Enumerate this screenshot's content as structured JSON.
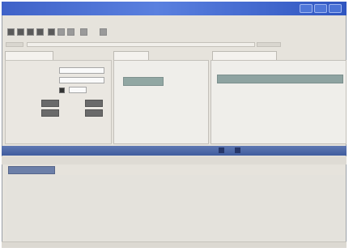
{
  "window": {
    "title": "",
    "controls": [
      "minimize-icon",
      "maximize-icon",
      "close-icon"
    ]
  },
  "menubar": {
    "items": []
  },
  "toolbar": {
    "text": ""
  },
  "tabs": {
    "left": "",
    "mid": "",
    "right": ""
  },
  "left_panel": {
    "labels": []
  },
  "mid_panel": {
    "selected_item": ""
  },
  "right_panel": {
    "header": "",
    "selected_item": ""
  },
  "bottom": {
    "splitter_text": "",
    "active_subtab": ""
  },
  "statusbar": {
    "left": "",
    "right": ""
  },
  "colors": {
    "titlebar": "#3f62c8",
    "selection": "#91a7a3",
    "splitter": "#4f6aa8"
  }
}
